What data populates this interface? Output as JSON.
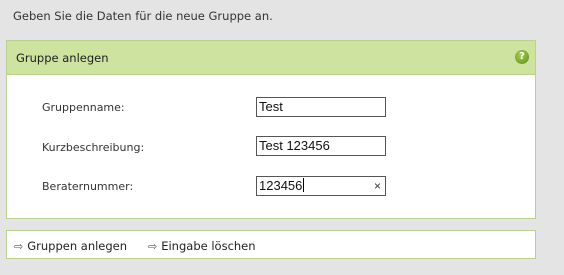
{
  "intro_text": "Geben Sie die Daten für die neue Gruppe an.",
  "panel": {
    "title": "Gruppe anlegen",
    "help_icon": "help-icon",
    "help_glyph": "?"
  },
  "form": {
    "gruppenname": {
      "label": "Gruppenname:",
      "value": "Test"
    },
    "kurzbeschreibung": {
      "label": "Kurzbeschreibung:",
      "value": "Test 123456"
    },
    "beraternummer": {
      "label": "Beraternummer:",
      "value": "123456",
      "clear_glyph": "×"
    }
  },
  "actions": {
    "create_label": "Gruppen anlegen",
    "reset_label": "Eingabe löschen",
    "arrow_glyph": "⇨"
  },
  "colors": {
    "header_bg": "#cde39f",
    "border": "#b9d38c",
    "page_bg": "#e4e4e4"
  }
}
